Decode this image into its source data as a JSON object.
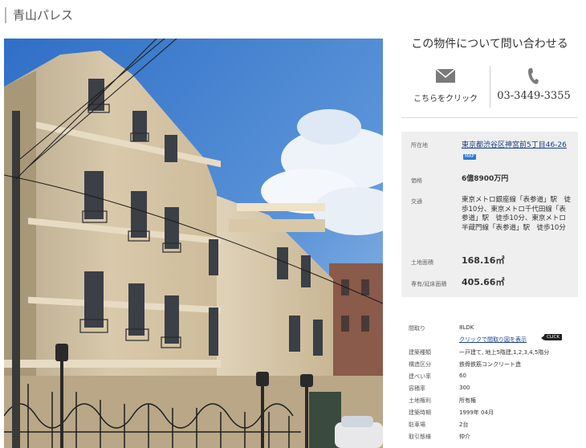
{
  "page": {
    "title": "青山パレス"
  },
  "contact": {
    "heading": "この物件について問い合わせる",
    "mail_label": "こちらをクリック",
    "phone": "03-3449-3355"
  },
  "summary": {
    "location": {
      "label": "所在地",
      "value": "東京都渋谷区神宮前5丁目46-26",
      "map_tag": "MAP"
    },
    "price": {
      "label": "価格",
      "value": "6億8900万円"
    },
    "transport": {
      "label": "交通",
      "value": "東京メトロ銀座線「表参道」駅　徒歩10分、東京メトロ千代田線「表参道」駅　徒歩10分、東京メトロ半蔵門線「表参道」駅　徒歩10分"
    },
    "land_area": {
      "label": "土地面積",
      "value": "168.16㎡"
    },
    "floor_area": {
      "label": "専有/延床面積",
      "value": "405.66㎡"
    }
  },
  "specs": {
    "floor_plan": {
      "label": "間取り",
      "value": "8LDK",
      "link": "クリックで間取り図を表示",
      "click_tag": "CLICK"
    },
    "rows": [
      {
        "label": "建築種類",
        "value": "一戸建て, 地上5階建,1,2,3,4,5階分"
      },
      {
        "label": "構造区分",
        "value": "鉄骨鉄筋コンクリート造"
      },
      {
        "label": "建ぺい率",
        "value": "60"
      },
      {
        "label": "容積率",
        "value": "300"
      },
      {
        "label": "土地権利",
        "value": "所有権"
      },
      {
        "label": "建築時期",
        "value": "1999年 04月"
      },
      {
        "label": "駐車場",
        "value": "2台"
      },
      {
        "label": "取引態様",
        "value": "仲介"
      }
    ]
  },
  "colors": {
    "info_bg": "#efefef",
    "link": "#1a3e8a",
    "map_tag": "#2a7bd4"
  },
  "icons": {
    "mail": "mail-icon",
    "phone": "phone-icon"
  }
}
